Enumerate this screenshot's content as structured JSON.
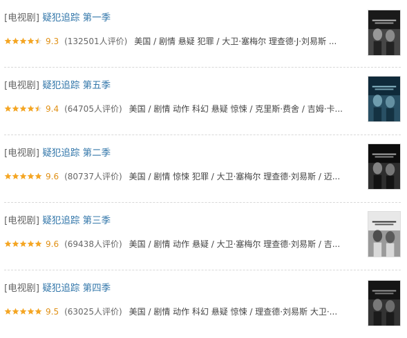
{
  "items": [
    {
      "tag": "[电视剧]",
      "title": "疑犯追踪 第一季",
      "rating": 9.3,
      "rating_text": "9.3",
      "stars": 4.5,
      "votes": "(132501人评价)",
      "info": "美国 / 剧情 悬疑 犯罪 / 大卫·塞梅尔 理查德·J·刘易斯 ...",
      "poster_colors": [
        "#1a1a1a",
        "#6b6b6b",
        "#cfcfcf"
      ]
    },
    {
      "tag": "[电视剧]",
      "title": "疑犯追踪 第五季",
      "rating": 9.4,
      "rating_text": "9.4",
      "stars": 4.5,
      "votes": "(64705人评价)",
      "info": "美国 / 剧情 动作 科幻 悬疑 惊悚 / 克里斯·费舍 / 吉姆·卡...",
      "poster_colors": [
        "#0f2a3a",
        "#3f6f86",
        "#9fd0e0"
      ]
    },
    {
      "tag": "[电视剧]",
      "title": "疑犯追踪 第二季",
      "rating": 9.6,
      "rating_text": "9.6",
      "stars": 5,
      "votes": "(80737人评价)",
      "info": "美国 / 剧情 惊悚 犯罪 / 大卫·塞梅尔 理查德·刘易斯 / 迈...",
      "poster_colors": [
        "#0d0d0d",
        "#4a4a4a",
        "#bdbdbd"
      ]
    },
    {
      "tag": "[电视剧]",
      "title": "疑犯追踪 第三季",
      "rating": 9.6,
      "rating_text": "9.6",
      "stars": 5,
      "votes": "(69438人评价)",
      "info": "美国 / 剧情 动作 悬疑 / 大卫·塞梅尔 理查德·刘易斯 / 吉...",
      "poster_colors": [
        "#e8e8e8",
        "#5a5a5a",
        "#1a1a1a"
      ]
    },
    {
      "tag": "[电视剧]",
      "title": "疑犯追踪 第四季",
      "rating": 9.5,
      "rating_text": "9.5",
      "stars": 5,
      "votes": "(63025人评价)",
      "info": "美国 / 剧情 动作 科幻 悬疑 惊悚 / 理查德·刘易斯 大卫·...",
      "poster_colors": [
        "#151515",
        "#4d4d4d",
        "#a8a8a8"
      ]
    }
  ]
}
